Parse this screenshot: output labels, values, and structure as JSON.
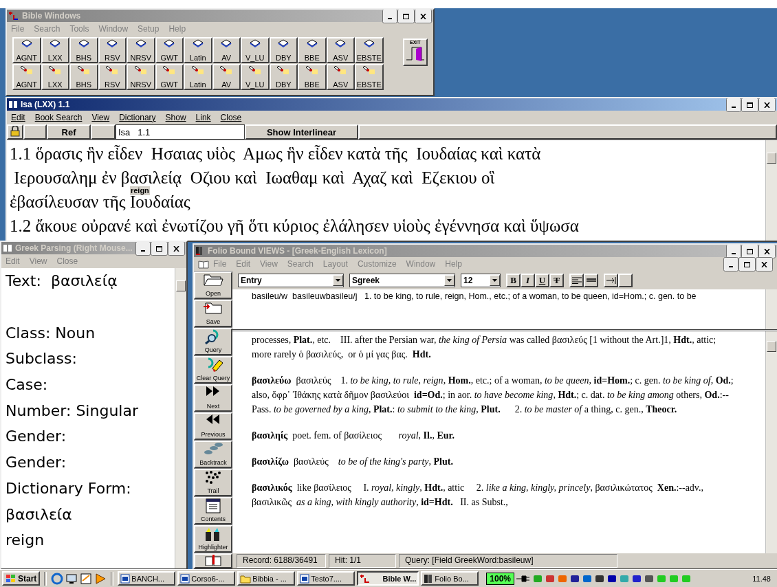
{
  "bible_window": {
    "title": "Bible Windows",
    "active": false,
    "menu": [
      "File",
      "Search",
      "Tools",
      "Window",
      "Setup",
      "Help"
    ],
    "button_rows": [
      {
        "kind": "book",
        "labels": [
          "AGNT",
          "LXX",
          "BHS",
          "RSV",
          "NRSV",
          "GWT",
          "Latin",
          "AV",
          "V_LU",
          "DBY",
          "BBE",
          "ASV",
          "EBSTE"
        ]
      },
      {
        "kind": "search",
        "labels": [
          "AGNT",
          "LXX",
          "BHS",
          "RSV",
          "NRSV",
          "GWT",
          "Latin",
          "AV",
          "V_LU",
          "DBY",
          "BBE",
          "ASV",
          "EBSTE"
        ]
      }
    ],
    "exit_label": "EXIT"
  },
  "passage_window": {
    "title": "Isa (LXX)  1.1",
    "active": true,
    "menu": [
      "Edit",
      "Book Search",
      "View",
      "Dictionary",
      "Show",
      "Link",
      "Close"
    ],
    "ref_button": "Ref",
    "ref_value": "Isa   1.1",
    "interlinear_button": "Show Interlinear",
    "lines": [
      {
        "text": "1.1 ὅρασις ἣν εἶδεν  Ησαιας υἱὸς  Αμως ἣν εἶδεν κατὰ τῆς  Ιουδαίας καὶ κατὰ"
      },
      {
        "text": " Ιερουσαλημ ἐν βασιλείᾳ  Οζιου καὶ  Ιωαθαμ καὶ  Αχαζ καὶ  Εζεκιου οἳ"
      },
      {
        "text": "ἐβασίλευσαν τῆς ",
        "hover_word": "Ιουδαίας",
        "tooltip": "reign"
      },
      {
        "text": "1.2 ἄκουε οὐρανέ καὶ ἐνωτίζου γῆ ὅτι κύριος ἐλάλησεν υἱοὺς ἐγέννησα καὶ ὕψωσα"
      }
    ]
  },
  "parsing_window": {
    "title": "Greek Parsing (Right Mouse...",
    "active": false,
    "menu": [
      "Edit",
      "View",
      "Close"
    ],
    "lines": [
      "Text:  βασιλείᾳ",
      "Class: Noun",
      "Subclass:",
      "Case:",
      "Number: Singular",
      "Gender:",
      "Gender:",
      "Dictionary Form:",
      "βασιλεία",
      "reign"
    ]
  },
  "lexicon_window": {
    "title": "Folio Bound VIEWS - [Greek-English Lexicon]",
    "active": false,
    "menu": [
      "File",
      "Edit",
      "View",
      "Search",
      "Layout",
      "Customize",
      "Window",
      "Help"
    ],
    "sidebar": [
      "Open",
      "Save",
      "Query",
      "Clear Query",
      "Next",
      "Previous",
      "Backtrack",
      "Trail",
      "Contents",
      "Highlighter"
    ],
    "style_select": "Entry",
    "font_select": "Sgreek",
    "size_select": "12",
    "format_buttons": [
      {
        "label": "B",
        "kind": "bold"
      },
      {
        "label": "I",
        "kind": "italic"
      },
      {
        "label": "U",
        "kind": "underline"
      },
      {
        "label": "T",
        "kind": "strike"
      }
    ],
    "header_text": "basileu/w  basileuwbasileu/j   1. to be king, to rule, reign, Hom., etc.; of a woman, to be queen, id=Hom.; c. gen. to be",
    "paragraphs": [
      "processes, **Plat.**, etc.    III. after the Persian war, *the king of Persia* was called βασιλεύς [1 without the Art.]1, **Hdt.**, attic; more rarely ὁ βασιλεύς,  or ὁ μί γας βας.  **Hdt.**",
      "**βασιλεύω**  βασιλεύς    1. *to be king, to rule, reign*, **Hom.**, etc.; of a woman, *to be queen*, **id=Hom.**; c. gen. *to be king of*, **Od.**; also, ὄφρ᾽ Ἰθάκης κατὰ δῆμον βασιλεύοι  **id=Od.**; in aor. *to have become king*, **Hdt.**; c. dat. *to be king among* others, **Od.**:--Pass. *to be governed by a king*, **Plat.**: *to submit to the king*, **Plut.**      2. *to be master of* a thing, c. gen., **Theocr.**",
      "**βασιληίς**  poet. fem. of βασίλειος       *royal*, **Il.**, **Eur.**",
      "**βασιλίζω**  βασιλεύς    *to be of the king's party*, **Plut.**",
      "**βασιλικός**  like βασίλειος     I. *royal, kingly*, **Hdt.**, attic     2. *like a king, kingly, princely*, βασιλικώτατος  **Xen.**:--adv., βασιλικῶς  *as a king, with kingly authority*, **id=Hdt.**   II. as Subst.,"
    ],
    "status": [
      "Record: 6188/36491",
      "Hit: 1/1",
      "Query: [Field GreekWord:basileuw]"
    ]
  },
  "taskbar": {
    "start": "Start",
    "tasks": [
      {
        "label": "BANCH...",
        "kind": "document",
        "selected": false
      },
      {
        "label": "Corso6-...",
        "kind": "document",
        "selected": false
      },
      {
        "label": "Bibbia - ...",
        "kind": "folder",
        "selected": false
      },
      {
        "label": "Testo7....",
        "kind": "document",
        "selected": false
      },
      {
        "label": "Bible W...",
        "kind": "bible",
        "selected": true
      },
      {
        "label": "Folio Bo...",
        "kind": "folio",
        "selected": false
      }
    ],
    "zoom": "100%",
    "clock": "11.48"
  }
}
